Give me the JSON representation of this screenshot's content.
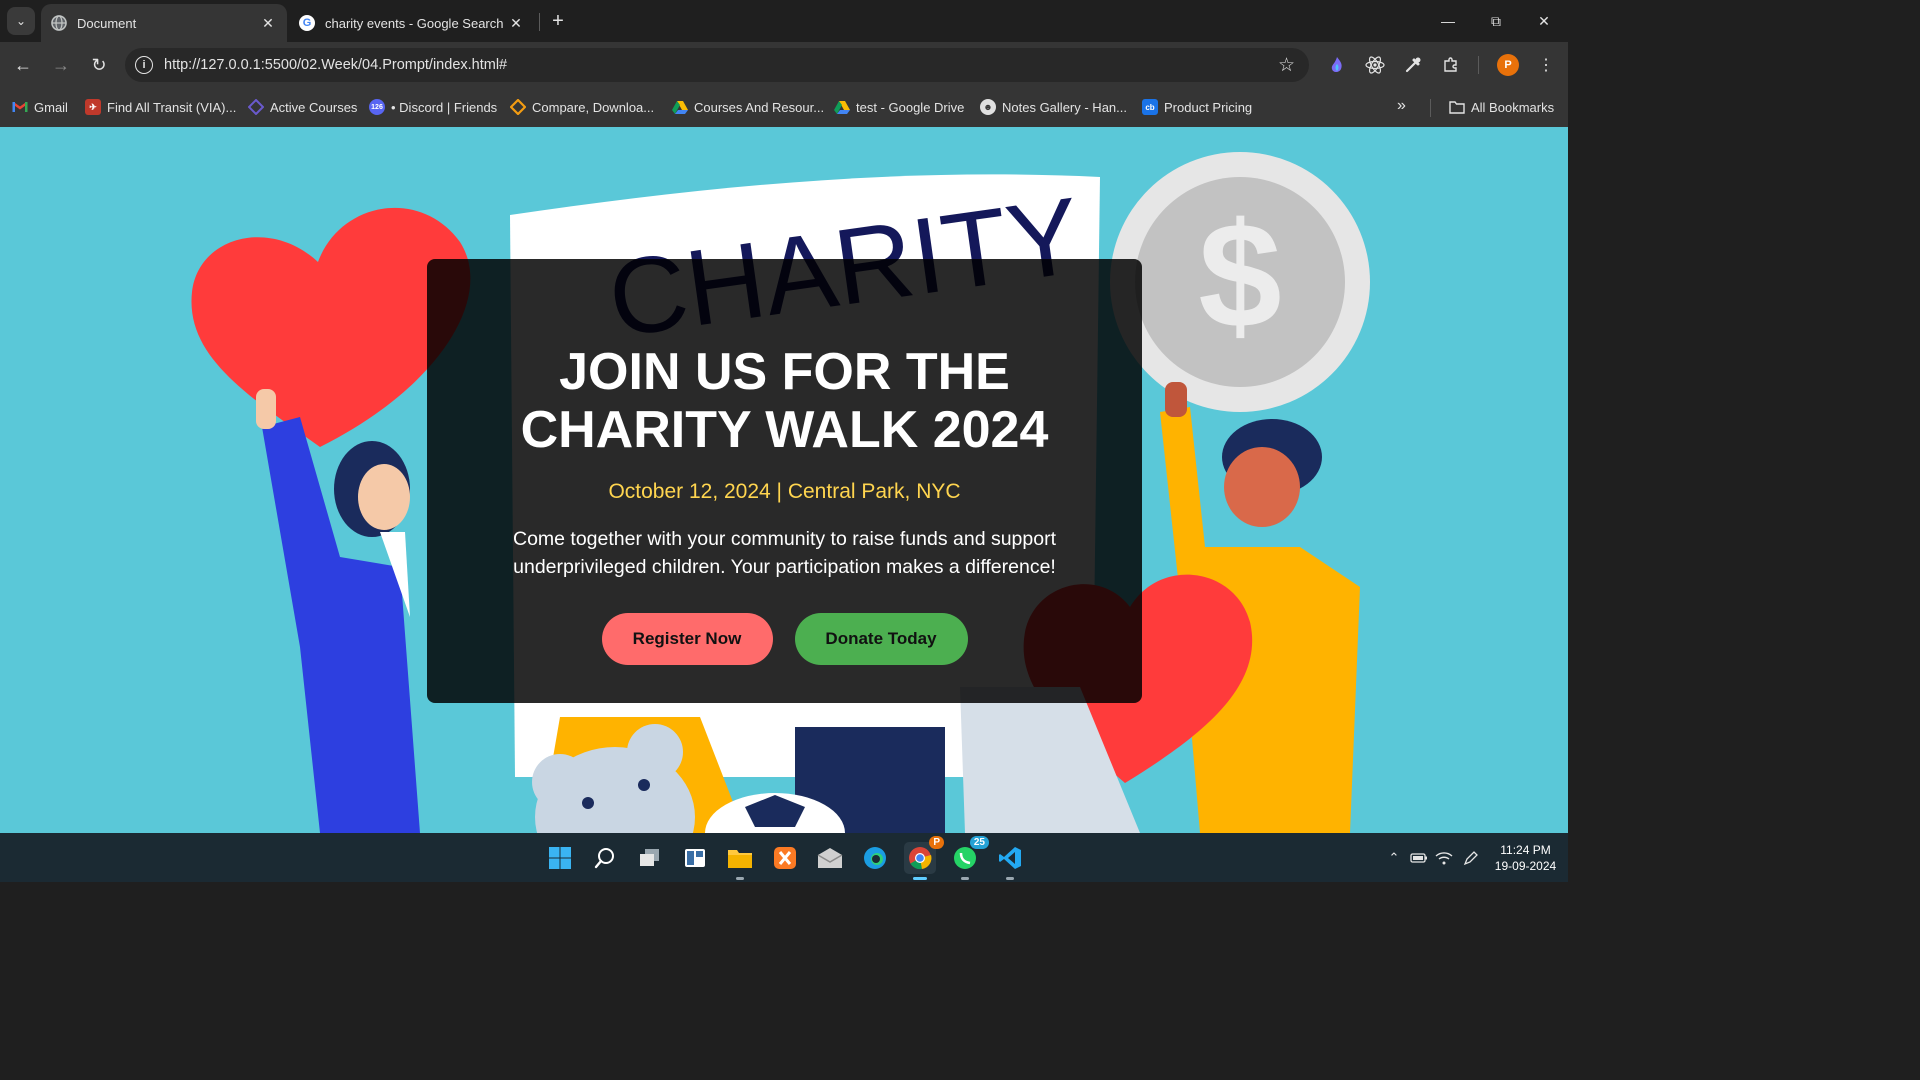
{
  "browser": {
    "tabs": [
      {
        "title": "Document",
        "active": true
      },
      {
        "title": "charity events - Google Search",
        "active": false
      }
    ],
    "address": "http://127.0.0.1:5500/02.Week/04.Prompt/index.html#",
    "profile_initial": "P",
    "bookmarks": [
      {
        "label": "Gmail",
        "icon": "gmail-icon"
      },
      {
        "label": "Find All Transit (VIA)...",
        "icon": "transit-icon"
      },
      {
        "label": "Active Courses",
        "icon": "courses-icon"
      },
      {
        "label": "• Discord | Friends",
        "icon": "discord-icon",
        "badge": "126"
      },
      {
        "label": "Compare, Downloa...",
        "icon": "compare-icon"
      },
      {
        "label": "Courses And Resour...",
        "icon": "google-drive-icon"
      },
      {
        "label": "test - Google Drive",
        "icon": "google-drive-icon"
      },
      {
        "label": "Notes Gallery - Han...",
        "icon": "notes-icon"
      },
      {
        "label": "Product Pricing",
        "icon": "cb-icon",
        "icon_text": "cb"
      }
    ],
    "all_bookmarks_label": "All Bookmarks"
  },
  "hero": {
    "banner_text": "CHARITY",
    "title": "JOIN US FOR THE CHARITY WALK 2024",
    "date_location": "October 12, 2024 | Central Park, NYC",
    "description": "Come together with your community to raise funds and support underprivileged children. Your participation makes a difference!",
    "register_label": "Register Now",
    "donate_label": "Donate Today"
  },
  "taskbar": {
    "apps": [
      "windows-start-icon",
      "search-icon",
      "task-view-icon",
      "widgets-icon",
      "file-explorer-icon",
      "xampp-icon",
      "mail-icon",
      "edge-icon",
      "chrome-icon",
      "whatsapp-icon",
      "vscode-icon"
    ],
    "whatsapp_badge": "25",
    "time": "11:24 PM",
    "date": "19-09-2024"
  },
  "colors": {
    "page_background": "#5ac8d8",
    "date_text": "#ffd54f",
    "register_button": "#ff6b6b",
    "donate_button": "#4caf50"
  }
}
